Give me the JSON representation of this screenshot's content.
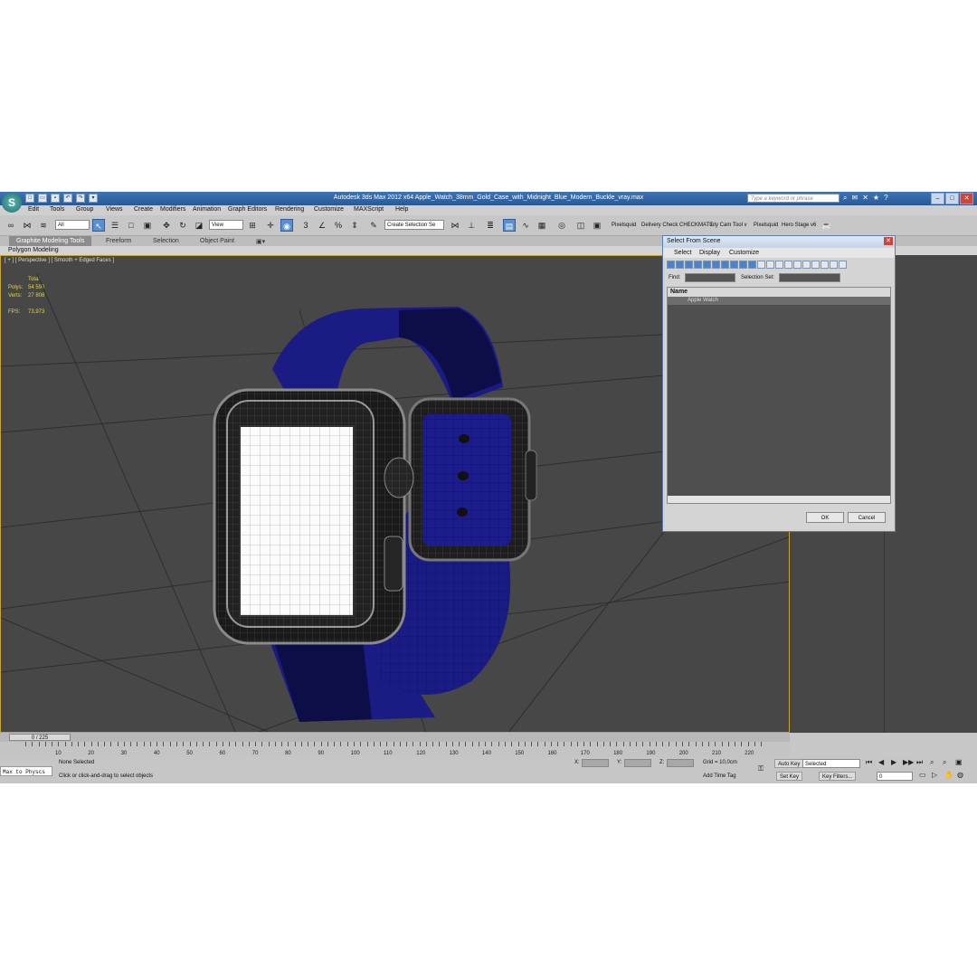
{
  "window": {
    "title": "Autodesk 3ds Max  2012 x64     Apple_Watch_38mm_Gold_Case_with_Midnight_Blue_Modern_Buckle_vray.max",
    "search_placeholder": "Type a keyword or phrase"
  },
  "menu": [
    "Edit",
    "Tools",
    "Group",
    "Views",
    "Create",
    "Modifiers",
    "Animation",
    "Graph Editors",
    "Rendering",
    "Customize",
    "MAXScript",
    "Help"
  ],
  "toolbar": {
    "filter_value": "All",
    "refcoord_value": "View",
    "selection_set_value": "Create Selection Se",
    "plugins": [
      "Pixelsquid",
      "Delivery Check",
      "CHECKMATE",
      "uty Cam Tool v",
      "Pixelsquid",
      "Hero Stage v6"
    ]
  },
  "ribbon": {
    "tabs": [
      "Graphite Modeling Tools",
      "Freeform",
      "Selection",
      "Object Paint"
    ],
    "sub": "Polygon Modeling"
  },
  "viewport": {
    "label": "[ + ] [ Perspective ] [ Smooth + Edged Faces ]",
    "stats": {
      "header": "Total",
      "polys_label": "Polys:",
      "polys_value": "54 590",
      "verts_label": "Verts:",
      "verts_value": "27 808",
      "fps_label": "FPS:",
      "fps_value": "73,973"
    }
  },
  "dialog": {
    "title": "Select From Scene",
    "menu": [
      "Select",
      "Display",
      "Customize"
    ],
    "find_label": "Find:",
    "selection_set_label": "Selection Set:",
    "column_name": "Name",
    "items": [
      "Apple Watch"
    ],
    "ok": "OK",
    "cancel": "Cancel"
  },
  "timeline": {
    "slider": "0 / 225",
    "ticks": [
      "10",
      "20",
      "30",
      "40",
      "50",
      "60",
      "70",
      "80",
      "90",
      "100",
      "110",
      "120",
      "130",
      "140",
      "150",
      "160",
      "170",
      "180",
      "190",
      "200",
      "210",
      "220"
    ]
  },
  "status": {
    "maxscript": "Max to Physcs",
    "selection": "None Selected",
    "prompt": "Click or click-and-drag to select objects",
    "x_label": "X:",
    "y_label": "Y:",
    "z_label": "Z:",
    "grid": "Grid = 10,0cm",
    "add_time_tag": "Add Time Tag",
    "auto_key": "Auto Key",
    "set_key": "Set Key",
    "key_mode": "Selected",
    "key_filters": "Key Filters...",
    "frame": "0"
  },
  "colors": {
    "accent": "#3b6fb0",
    "viewport_bg": "#474747",
    "band": "#1a1a7a",
    "stats_text": "#e6d73c"
  }
}
